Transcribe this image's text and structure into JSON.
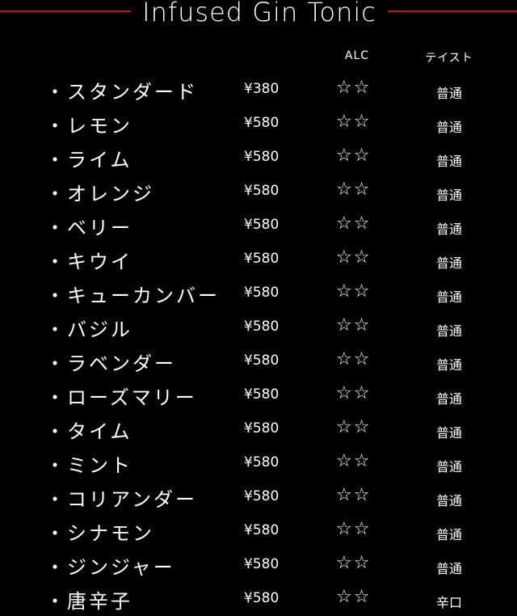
{
  "menu": {
    "title": "Infused Gin Tonic",
    "headers": {
      "alc": "ALC",
      "taste": "テイスト"
    },
    "items": [
      {
        "name": "・スタンダード",
        "price": "¥380",
        "alc": "☆☆",
        "taste": "普通"
      },
      {
        "name": "・レモン",
        "price": "¥580",
        "alc": "☆☆",
        "taste": "普通"
      },
      {
        "name": "・ライム",
        "price": "¥580",
        "alc": "☆☆",
        "taste": "普通"
      },
      {
        "name": "・オレンジ",
        "price": "¥580",
        "alc": "☆☆",
        "taste": "普通"
      },
      {
        "name": "・ベリー",
        "price": "¥580",
        "alc": "☆☆",
        "taste": "普通"
      },
      {
        "name": "・キウイ",
        "price": "¥580",
        "alc": "☆☆",
        "taste": "普通"
      },
      {
        "name": "・キューカンバー",
        "price": "¥580",
        "alc": "☆☆",
        "taste": "普通"
      },
      {
        "name": "・バジル",
        "price": "¥580",
        "alc": "☆☆",
        "taste": "普通"
      },
      {
        "name": "・ラベンダー",
        "price": "¥580",
        "alc": "☆☆",
        "taste": "普通"
      },
      {
        "name": "・ローズマリー",
        "price": "¥580",
        "alc": "☆☆",
        "taste": "普通"
      },
      {
        "name": "・タイム",
        "price": "¥580",
        "alc": "☆☆",
        "taste": "普通"
      },
      {
        "name": "・ミント",
        "price": "¥580",
        "alc": "☆☆",
        "taste": "普通"
      },
      {
        "name": "・コリアンダー",
        "price": "¥580",
        "alc": "☆☆",
        "taste": "普通"
      },
      {
        "name": "・シナモン",
        "price": "¥580",
        "alc": "☆☆",
        "taste": "普通"
      },
      {
        "name": "・ジンジャー",
        "price": "¥580",
        "alc": "☆☆",
        "taste": "普通"
      },
      {
        "name": "・唐辛子",
        "price": "¥580",
        "alc": "☆☆",
        "taste": "辛口"
      }
    ]
  },
  "colors": {
    "background": "#000000",
    "text": "#ffffff",
    "accent_line": "#c8102e"
  }
}
